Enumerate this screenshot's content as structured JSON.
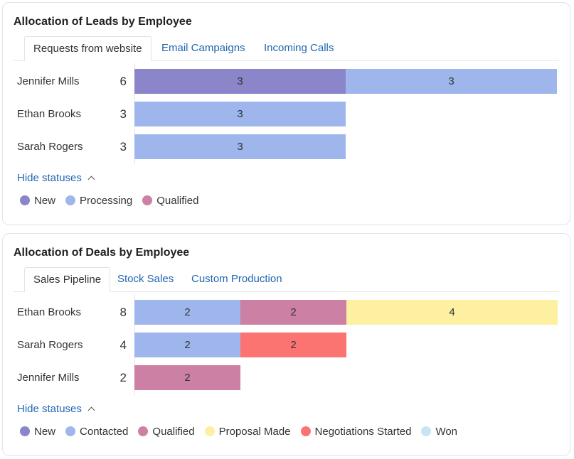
{
  "statuses": {
    "new": {
      "label": "New",
      "color": "#8a86c9"
    },
    "processing": {
      "label": "Processing",
      "color": "#9eb6ec"
    },
    "qualified": {
      "label": "Qualified",
      "color": "#cc80a3"
    },
    "contacted": {
      "label": "Contacted",
      "color": "#9eb6ec"
    },
    "proposal": {
      "label": "Proposal Made",
      "color": "#fdf0a0"
    },
    "negotiations": {
      "label": "Negotiations Started",
      "color": "#fc7472"
    },
    "won": {
      "label": "Won",
      "color": "#c7e6f2"
    }
  },
  "leads": {
    "title": "Allocation of Leads by Employee",
    "tabs": [
      "Requests from website",
      "Email Campaigns",
      "Incoming Calls"
    ],
    "active_tab": 0,
    "hide_statuses_label": "Hide statuses",
    "legend": [
      "new",
      "processing",
      "qualified"
    ],
    "chart_data": {
      "type": "bar",
      "orientation": "horizontal-stacked",
      "categories": [
        "Jennifer Mills",
        "Ethan Brooks",
        "Sarah Rogers"
      ],
      "totals": [
        6,
        3,
        3
      ],
      "max": 6,
      "series": [
        {
          "name": "New",
          "status": "new",
          "values": [
            3,
            0,
            0
          ]
        },
        {
          "name": "Processing",
          "status": "processing",
          "values": [
            3,
            3,
            3
          ]
        },
        {
          "name": "Qualified",
          "status": "qualified",
          "values": [
            0,
            0,
            0
          ]
        }
      ]
    }
  },
  "deals": {
    "title": "Allocation of Deals by Employee",
    "tabs": [
      "Sales Pipeline",
      "Stock Sales",
      "Custom Production"
    ],
    "active_tab": 0,
    "hide_statuses_label": "Hide statuses",
    "legend": [
      "new",
      "contacted",
      "qualified",
      "proposal",
      "negotiations",
      "won"
    ],
    "chart_data": {
      "type": "bar",
      "orientation": "horizontal-stacked",
      "categories": [
        "Ethan Brooks",
        "Sarah Rogers",
        "Jennifer Mills"
      ],
      "totals": [
        8,
        4,
        2
      ],
      "max": 8,
      "series": [
        {
          "name": "New",
          "status": "new",
          "values": [
            0,
            0,
            0
          ]
        },
        {
          "name": "Contacted",
          "status": "contacted",
          "values": [
            2,
            2,
            0
          ]
        },
        {
          "name": "Qualified",
          "status": "qualified",
          "values": [
            2,
            0,
            2
          ]
        },
        {
          "name": "Proposal Made",
          "status": "proposal",
          "values": [
            4,
            0,
            0
          ]
        },
        {
          "name": "Negotiations Started",
          "status": "negotiations",
          "values": [
            0,
            2,
            0
          ]
        },
        {
          "name": "Won",
          "status": "won",
          "values": [
            0,
            0,
            0
          ]
        }
      ]
    }
  }
}
